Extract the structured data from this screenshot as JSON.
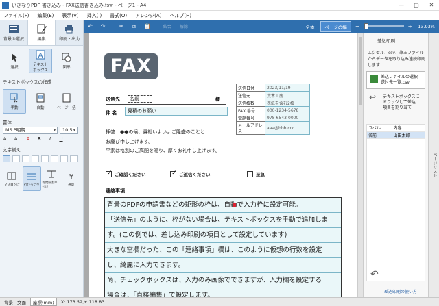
{
  "window": {
    "title": "いきなりPDF 書き込み - FAX送信書き込み.fsw - ページ1 - A4",
    "min": "—",
    "max": "▢",
    "close": "✕"
  },
  "menu": [
    "ファイル(F)",
    "編集(E)",
    "表示(V)",
    "挿入(I)",
    "書式(O)",
    "アレンジ(A)",
    "ヘルプ(H)"
  ],
  "ribbon": {
    "tabs": [
      "背景の選択",
      "編集",
      "印刷・出力"
    ]
  },
  "tools": {
    "select": "選択",
    "textbox": "テキスト\nボックス",
    "shape": "図形"
  },
  "textbox_create": {
    "label": "テキストボックスの作成",
    "manual": "手動",
    "auto": "自動",
    "page_all": "ページ一括"
  },
  "font": {
    "label": "書体",
    "name": "MS P明朝",
    "size": "10.5",
    "buttons": [
      "A⁺",
      "A⁻",
      "A",
      "B",
      "I",
      "U"
    ]
  },
  "align": {
    "label": "文字揃え",
    "options": [
      "マス目だけ",
      "行ぴったり",
      "等間隔割り付け",
      "通貨"
    ]
  },
  "toolbar": {
    "undo": "↶",
    "redo": "↷",
    "cut": "✂",
    "copy": "⧉",
    "paste": "📋",
    "group": "結合",
    "ungroup": "解除",
    "fit_all": "全体",
    "fit_width": "ページの幅",
    "zoom_minus": "−",
    "zoom_plus": "+",
    "zoom": "13.93%"
  },
  "doc": {
    "logo": "FAX",
    "to_label": "送信先",
    "to_value": "名前",
    "sama": "様",
    "subject_label": "件 名",
    "subject_value": "見積のお願い",
    "info": [
      {
        "k": "送信日付",
        "v": "2023/11/19"
      },
      {
        "k": "送信元",
        "v": "荒木工房"
      },
      {
        "k": "送信枚数",
        "v": "表紙を含む2枚"
      },
      {
        "k": "FAX 番号",
        "v": "000-1234-5678"
      },
      {
        "k": "電話番号",
        "v": "978-6543-0000"
      },
      {
        "k": "メールアドレス",
        "v": "aaa@bbb.ccc"
      }
    ],
    "greeting": [
      "拝啓　●●の候、貴社いよいよご隆盛のことと",
      "お慶び申し上げます。",
      "平素は格別のご高配を賜り、厚くお礼申し上げます。"
    ],
    "checks": [
      {
        "label": "ご確認ください",
        "checked": true
      },
      {
        "label": "ご返信ください",
        "checked": true
      },
      {
        "label": "至急",
        "checked": false
      }
    ],
    "notes_title": "連絡事項",
    "notes": [
      "背景のPDFの申請書などの矩形の枠は、自動で入力枠に設定可能。",
      "「送信先」のように、枠がない場合は、テキストボックスを手動で追加しま",
      "す。(この例では、差し込み印刷の項目として設定しています)",
      "大きな空欄だった、この「連絡事項」欄は、このように仮想の行数を設定",
      "し、綺麗に入力できます。",
      "尚、チェックボックスは、入力のみ画像でできますが、入力欄を設定する",
      "場合は、「直接編集」で設定します。"
    ]
  },
  "right": {
    "title": "差込印刷",
    "desc": "エクセル、csv、筆王ファイルからデータを取り込み連続印刷します",
    "button": "差込ファイルの選択\n送付先一覧.csv",
    "drag": "テキストボックスに\nドラッグして差込\n項目を割り当て",
    "table_head": [
      "ラベル",
      "内容"
    ],
    "table_rows": [
      [
        "名前",
        "山田太郎"
      ]
    ],
    "help": "差込印刷の使い方",
    "sidetab": "ページリスト"
  },
  "status": {
    "bg": "背景",
    "text": "文面",
    "coord_label": "座標(mm)",
    "coord": "X: 173.52,Y: 118.83"
  }
}
